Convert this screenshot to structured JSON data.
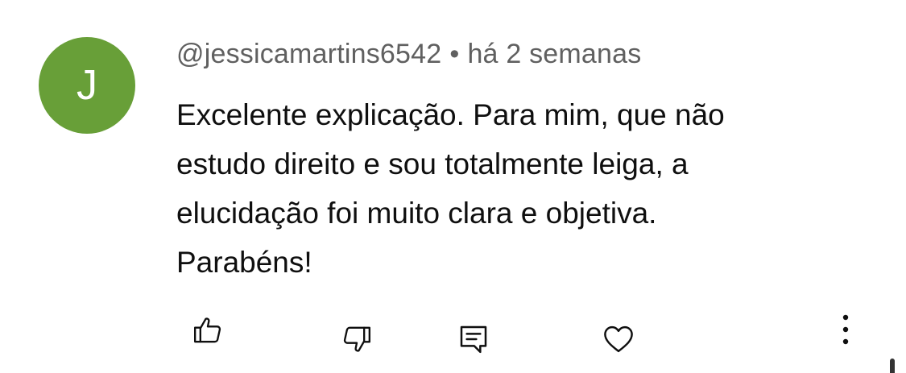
{
  "comment": {
    "avatar_letter": "J",
    "avatar_color": "#689f38",
    "author": "@jessicamartins6542",
    "separator": "•",
    "time": "há 2 semanas",
    "text_lines": [
      "Excelente explicação. Para mim, que não",
      "estudo direito e sou totalmente leiga, a",
      "elucidação foi muito clara e objetiva.",
      "Parabéns!"
    ]
  },
  "actions": {
    "icons": [
      "thumbs-up-icon",
      "thumbs-down-icon",
      "reply-icon",
      "heart-icon",
      "more-vert-icon"
    ]
  }
}
